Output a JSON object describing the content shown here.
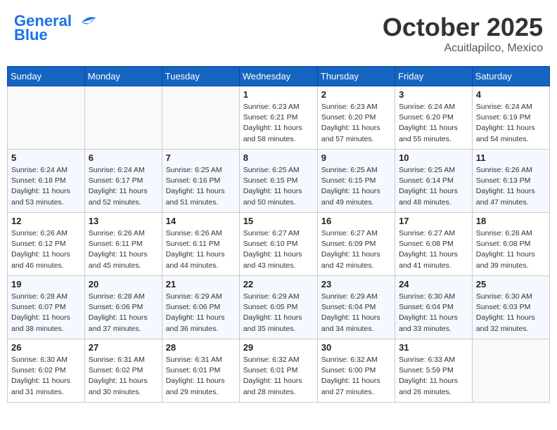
{
  "header": {
    "logo_line1": "General",
    "logo_line2": "Blue",
    "month": "October 2025",
    "location": "Acuitlapilco, Mexico"
  },
  "weekdays": [
    "Sunday",
    "Monday",
    "Tuesday",
    "Wednesday",
    "Thursday",
    "Friday",
    "Saturday"
  ],
  "weeks": [
    [
      {
        "day": "",
        "info": ""
      },
      {
        "day": "",
        "info": ""
      },
      {
        "day": "",
        "info": ""
      },
      {
        "day": "1",
        "info": "Sunrise: 6:23 AM\nSunset: 6:21 PM\nDaylight: 11 hours\nand 58 minutes."
      },
      {
        "day": "2",
        "info": "Sunrise: 6:23 AM\nSunset: 6:20 PM\nDaylight: 11 hours\nand 57 minutes."
      },
      {
        "day": "3",
        "info": "Sunrise: 6:24 AM\nSunset: 6:20 PM\nDaylight: 11 hours\nand 55 minutes."
      },
      {
        "day": "4",
        "info": "Sunrise: 6:24 AM\nSunset: 6:19 PM\nDaylight: 11 hours\nand 54 minutes."
      }
    ],
    [
      {
        "day": "5",
        "info": "Sunrise: 6:24 AM\nSunset: 6:18 PM\nDaylight: 11 hours\nand 53 minutes."
      },
      {
        "day": "6",
        "info": "Sunrise: 6:24 AM\nSunset: 6:17 PM\nDaylight: 11 hours\nand 52 minutes."
      },
      {
        "day": "7",
        "info": "Sunrise: 6:25 AM\nSunset: 6:16 PM\nDaylight: 11 hours\nand 51 minutes."
      },
      {
        "day": "8",
        "info": "Sunrise: 6:25 AM\nSunset: 6:15 PM\nDaylight: 11 hours\nand 50 minutes."
      },
      {
        "day": "9",
        "info": "Sunrise: 6:25 AM\nSunset: 6:15 PM\nDaylight: 11 hours\nand 49 minutes."
      },
      {
        "day": "10",
        "info": "Sunrise: 6:25 AM\nSunset: 6:14 PM\nDaylight: 11 hours\nand 48 minutes."
      },
      {
        "day": "11",
        "info": "Sunrise: 6:26 AM\nSunset: 6:13 PM\nDaylight: 11 hours\nand 47 minutes."
      }
    ],
    [
      {
        "day": "12",
        "info": "Sunrise: 6:26 AM\nSunset: 6:12 PM\nDaylight: 11 hours\nand 46 minutes."
      },
      {
        "day": "13",
        "info": "Sunrise: 6:26 AM\nSunset: 6:11 PM\nDaylight: 11 hours\nand 45 minutes."
      },
      {
        "day": "14",
        "info": "Sunrise: 6:26 AM\nSunset: 6:11 PM\nDaylight: 11 hours\nand 44 minutes."
      },
      {
        "day": "15",
        "info": "Sunrise: 6:27 AM\nSunset: 6:10 PM\nDaylight: 11 hours\nand 43 minutes."
      },
      {
        "day": "16",
        "info": "Sunrise: 6:27 AM\nSunset: 6:09 PM\nDaylight: 11 hours\nand 42 minutes."
      },
      {
        "day": "17",
        "info": "Sunrise: 6:27 AM\nSunset: 6:08 PM\nDaylight: 11 hours\nand 41 minutes."
      },
      {
        "day": "18",
        "info": "Sunrise: 6:28 AM\nSunset: 6:08 PM\nDaylight: 11 hours\nand 39 minutes."
      }
    ],
    [
      {
        "day": "19",
        "info": "Sunrise: 6:28 AM\nSunset: 6:07 PM\nDaylight: 11 hours\nand 38 minutes."
      },
      {
        "day": "20",
        "info": "Sunrise: 6:28 AM\nSunset: 6:06 PM\nDaylight: 11 hours\nand 37 minutes."
      },
      {
        "day": "21",
        "info": "Sunrise: 6:29 AM\nSunset: 6:06 PM\nDaylight: 11 hours\nand 36 minutes."
      },
      {
        "day": "22",
        "info": "Sunrise: 6:29 AM\nSunset: 6:05 PM\nDaylight: 11 hours\nand 35 minutes."
      },
      {
        "day": "23",
        "info": "Sunrise: 6:29 AM\nSunset: 6:04 PM\nDaylight: 11 hours\nand 34 minutes."
      },
      {
        "day": "24",
        "info": "Sunrise: 6:30 AM\nSunset: 6:04 PM\nDaylight: 11 hours\nand 33 minutes."
      },
      {
        "day": "25",
        "info": "Sunrise: 6:30 AM\nSunset: 6:03 PM\nDaylight: 11 hours\nand 32 minutes."
      }
    ],
    [
      {
        "day": "26",
        "info": "Sunrise: 6:30 AM\nSunset: 6:02 PM\nDaylight: 11 hours\nand 31 minutes."
      },
      {
        "day": "27",
        "info": "Sunrise: 6:31 AM\nSunset: 6:02 PM\nDaylight: 11 hours\nand 30 minutes."
      },
      {
        "day": "28",
        "info": "Sunrise: 6:31 AM\nSunset: 6:01 PM\nDaylight: 11 hours\nand 29 minutes."
      },
      {
        "day": "29",
        "info": "Sunrise: 6:32 AM\nSunset: 6:01 PM\nDaylight: 11 hours\nand 28 minutes."
      },
      {
        "day": "30",
        "info": "Sunrise: 6:32 AM\nSunset: 6:00 PM\nDaylight: 11 hours\nand 27 minutes."
      },
      {
        "day": "31",
        "info": "Sunrise: 6:33 AM\nSunset: 5:59 PM\nDaylight: 11 hours\nand 26 minutes."
      },
      {
        "day": "",
        "info": ""
      }
    ]
  ]
}
